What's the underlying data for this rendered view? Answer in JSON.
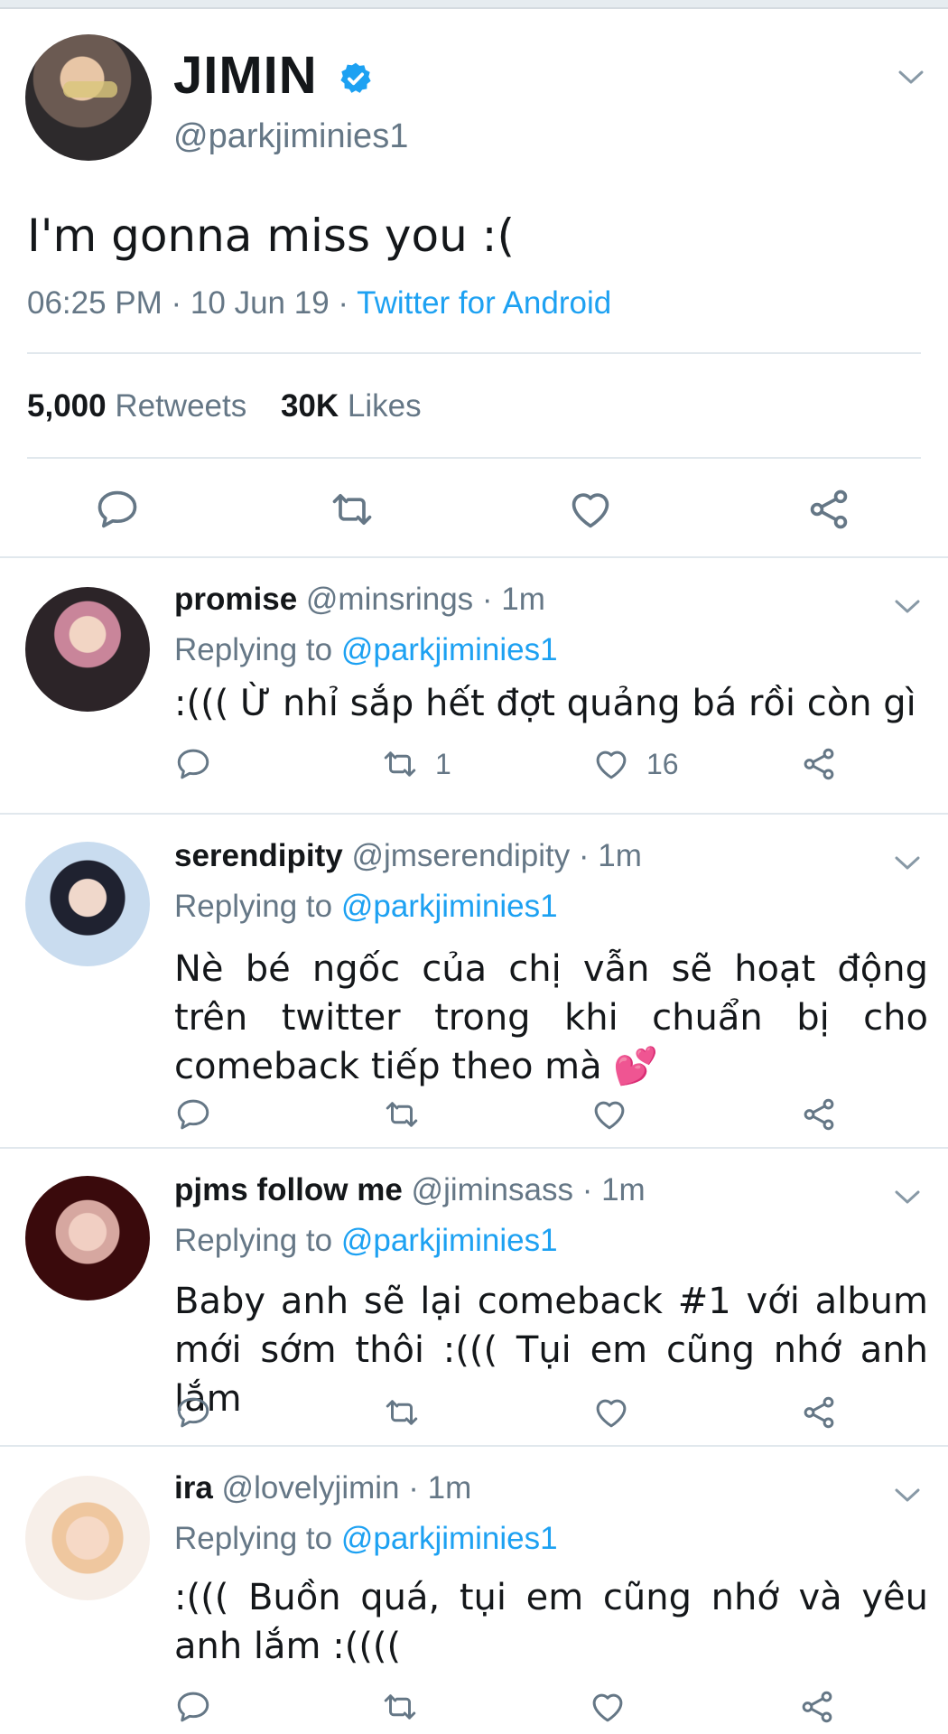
{
  "main_tweet": {
    "display_name": "JIMIN",
    "handle": "@parkjiminies1",
    "text": "I'm gonna miss you :(",
    "time": "06:25 PM · 10 Jun 19 · ",
    "source": "Twitter for Android",
    "retweets_count": "5,000",
    "retweets_label": "Retweets",
    "likes_count": "30K",
    "likes_label": "Likes",
    "icons": {
      "verified": "verified-badge-icon",
      "menu": "chevron-down-icon",
      "reply": "reply-icon",
      "retweet": "retweet-icon",
      "like": "heart-icon",
      "share": "share-icon"
    }
  },
  "replies": [
    {
      "display_name": "promise",
      "handle": "@minsrings · 1m",
      "replying_prefix": "Replying to ",
      "replying_to": "@parkjiminies1",
      "text": ":((( Ừ nhỉ sắp hết đợt quảng bá rồi còn gì",
      "retweets": "1",
      "likes": "16"
    },
    {
      "display_name": "serendipity",
      "handle": "@jmserendipity · 1m",
      "replying_prefix": "Replying to ",
      "replying_to": "@parkjiminies1",
      "text": "Nè bé ngốc của chị vẫn sẽ hoạt động trên twitter trong khi chuẩn bị cho comeback tiếp theo mà 💕",
      "retweets": "",
      "likes": ""
    },
    {
      "display_name": "pjms follow me",
      "handle": "@jiminsass · 1m",
      "replying_prefix": "Replying to ",
      "replying_to": "@parkjiminies1",
      "text": "Baby anh sẽ lại comeback #1 với album mới sớm thôi :((( Tụi em cũng nhớ anh lắm",
      "retweets": "",
      "likes": ""
    },
    {
      "display_name": "ira",
      "handle": "@lovelyjimin · 1m",
      "replying_prefix": "Replying to ",
      "replying_to": "@parkjiminies1",
      "text": ":((( Buồn quá, tụi em cũng nhớ và yêu anh lắm :((((",
      "retweets": "",
      "likes": ""
    }
  ],
  "colors": {
    "accent": "#1da1f2",
    "secondary_text": "#657786",
    "primary_text": "#14171a",
    "divider": "#e1e8ed",
    "heart_emoji": "#e0245e"
  }
}
